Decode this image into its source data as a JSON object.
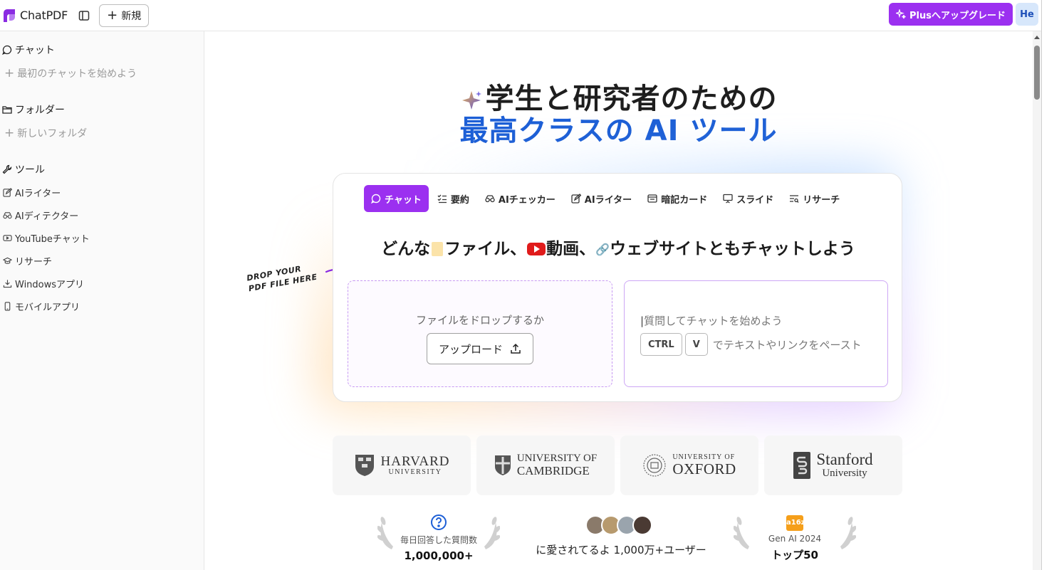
{
  "topbar": {
    "app_name": "ChatPDF",
    "new_label": "新規",
    "upgrade_label": "Plusへアップグレード",
    "avatar_initials": "He"
  },
  "sidebar": {
    "chat_header": "チャット",
    "chat_start": "最初のチャットを始めよう",
    "folder_header": "フォルダー",
    "folder_new": "新しいフォルダ",
    "tools_header": "ツール",
    "tools": [
      {
        "label": "AIライター",
        "icon": "pencil-icon"
      },
      {
        "label": "AIディテクター",
        "icon": "detector-icon"
      },
      {
        "label": "YouTubeチャット",
        "icon": "youtube-icon"
      },
      {
        "label": "リサーチ",
        "icon": "mortarboard-icon"
      },
      {
        "label": "Windowsアプリ",
        "icon": "download-icon"
      },
      {
        "label": "モバイルアプリ",
        "icon": "phone-icon"
      }
    ]
  },
  "hero": {
    "line1": "学生と研究者のための",
    "line2": "最高クラスの AI ツール"
  },
  "card": {
    "tabs": [
      {
        "label": "チャット",
        "icon": "chat-bubble-icon",
        "active": true
      },
      {
        "label": "要約",
        "icon": "checklist-icon",
        "active": false
      },
      {
        "label": "AIチェッカー",
        "icon": "detector-icon",
        "active": false
      },
      {
        "label": "AIライター",
        "icon": "pencil-icon",
        "active": false
      },
      {
        "label": "暗記カード",
        "icon": "flashcard-icon",
        "active": false
      },
      {
        "label": "スライド",
        "icon": "presentation-icon",
        "active": false
      },
      {
        "label": "リサーチ",
        "icon": "research-icon",
        "active": false
      }
    ],
    "title_part1": "どんな",
    "title_part2": "ファイル、",
    "title_part3": "動画、",
    "title_part4": "ウェブサイトともチャットしよう",
    "drop_label": "ファイルをドロップするか",
    "upload_label": "アップロード",
    "chat_placeholder": "質問してチャットを始めよう",
    "key_ctrl": "CTRL",
    "key_v": "V",
    "paste_hint": "でテキストやリンクをペースト",
    "drop_note_line1": "DROP YOUR",
    "drop_note_line2": "PDF FILE HERE"
  },
  "logos": {
    "harvard_1": "HARVARD",
    "harvard_2": "UNIVERSITY",
    "cambridge_1": "UNIVERSITY OF",
    "cambridge_2": "CAMBRIDGE",
    "oxford_1": "UNIVERSITY OF",
    "oxford_2": "OXFORD",
    "stanford_1": "Stanford",
    "stanford_2": "University"
  },
  "stats": {
    "questions_label": "毎日回答した質問数",
    "questions_value": "1,000,000+",
    "users_text": "に愛されてるよ 1,000万+ユーザー",
    "award_logo": "a16z",
    "award_label": "Gen AI 2024",
    "award_value": "トップ50"
  },
  "colors": {
    "accent": "#9b30f0",
    "hero_blue": "#1d5fd6",
    "avatar_bg": "#d7e7fb"
  }
}
